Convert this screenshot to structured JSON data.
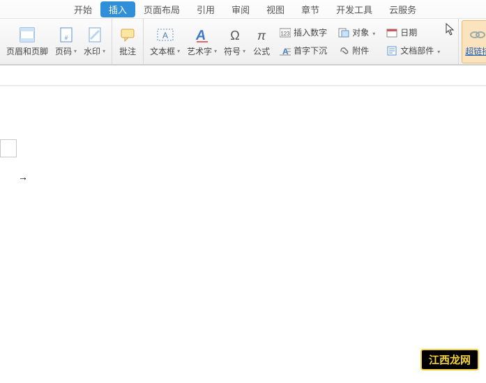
{
  "tabs": {
    "start": "开始",
    "insert": "插入",
    "layout": "页面布局",
    "reference": "引用",
    "review": "审阅",
    "view": "视图",
    "chapter": "章节",
    "devtools": "开发工具",
    "cloud": "云服务"
  },
  "toolbar": {
    "header_footer": "页眉和页脚",
    "page_number": "页码",
    "watermark": "水印",
    "comment": "批注",
    "textbox": "文本框",
    "wordart": "艺术字",
    "symbol": "符号",
    "equation": "公式",
    "insert_number": "插入数字",
    "drop_cap": "首字下沉",
    "object": "对象",
    "attachment": "附件",
    "date": "日期",
    "doc_parts": "文档部件",
    "hyperlink": "超链接"
  },
  "doc": {
    "arrow": "→"
  },
  "watermark_site": "江西龙网"
}
